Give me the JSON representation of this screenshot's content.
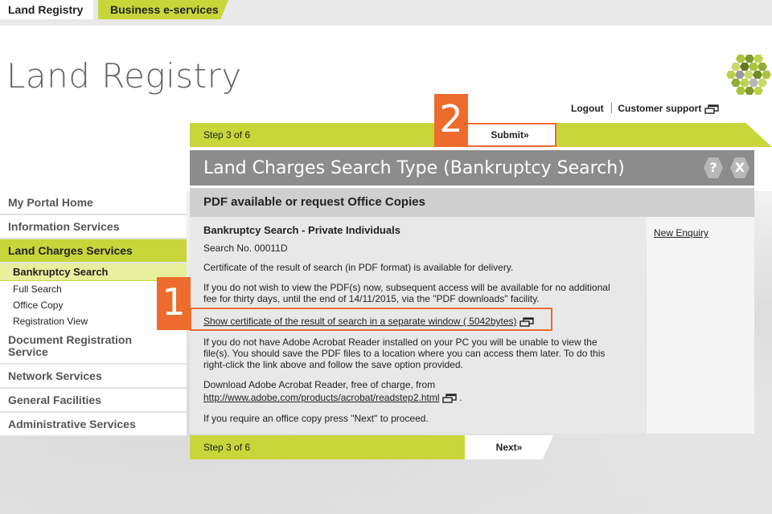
{
  "tabs": {
    "land_registry": "Land Registry",
    "business_eservices": "Business e-services"
  },
  "logo": {
    "text": "Land Registry"
  },
  "utility": {
    "logout": "Logout",
    "support": "Customer support"
  },
  "step_top": {
    "label": "Step 3 of 6",
    "action": "Submit»"
  },
  "step_bottom": {
    "label": "Step 3 of 6",
    "action": "Next»"
  },
  "title": "Land Charges Search Type (Bankruptcy Search)",
  "title_icons": {
    "help": "?",
    "close": "X"
  },
  "subtitle": "PDF available or request Office Copies",
  "content": {
    "heading": "Bankruptcy Search - Private Individuals",
    "search_no": "Search No. 00011D",
    "p1": "Certificate of the result of search (in PDF format) is available for delivery.",
    "p2a": "If you do not wish to view the PDF(s) now, subsequent access will be available for no additional",
    "p2b": "fee for thirty days, until the end of 14/11/2015, via the \"PDF downloads\" facility.",
    "show_link": "Show certificate of the result of search in a separate window ( 5042bytes)",
    "p3a": "If you do not have Adobe Acrobat Reader installed on your PC you will be unable to view the",
    "p3b": "file(s). You should save the PDF files to a location where you can access them later. To do this",
    "p3c": "right-click the link above and follow the save option provided.",
    "p4": "Download Adobe Acrobat Reader, free of charge, from",
    "adobe_link": "http://www.adobe.com/products/acrobat/readstep2.html",
    "adobe_dot": ".",
    "p5": "If you require an office copy press \"Next\" to proceed."
  },
  "side_panel": {
    "new_enquiry": "New Enquiry"
  },
  "nav": {
    "items": [
      {
        "label": "My Portal Home"
      },
      {
        "label": "Information Services"
      },
      {
        "label": "Land Charges Services"
      }
    ],
    "subitems": [
      {
        "label": "Bankruptcy Search"
      },
      {
        "label": "Full Search"
      },
      {
        "label": "Office Copy"
      },
      {
        "label": "Registration View"
      }
    ],
    "items_after": [
      {
        "label_line1": "Document Registration",
        "label_line2": "Service"
      },
      {
        "label": "Network Services"
      },
      {
        "label": "General Facilities"
      },
      {
        "label": "Administrative Services"
      }
    ]
  },
  "callouts": {
    "one": "1",
    "two": "2"
  },
  "colors": {
    "accent": "#c8d63a",
    "callout": "#ec6b2d",
    "title_bg": "#8c8c8c"
  }
}
